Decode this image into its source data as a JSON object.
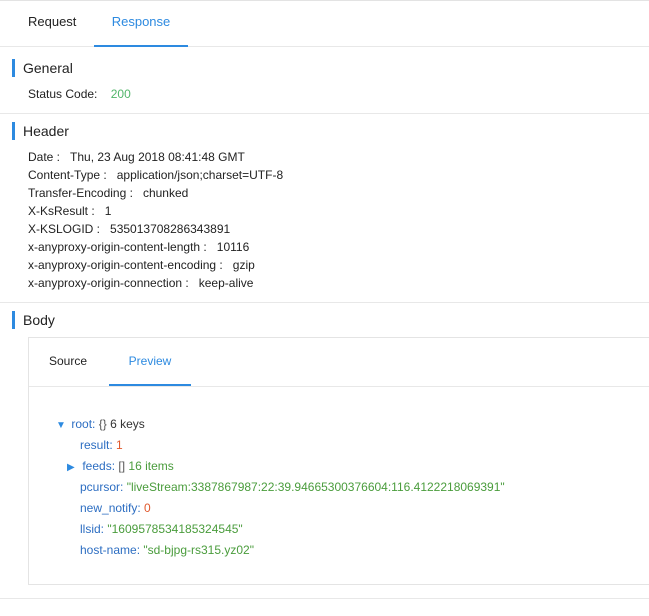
{
  "tabs": {
    "request": "Request",
    "response": "Response"
  },
  "general": {
    "title": "General",
    "status_label": "Status Code:",
    "status_value": "200"
  },
  "header": {
    "title": "Header",
    "rows": [
      {
        "k": "Date :",
        "v": "Thu, 23 Aug 2018 08:41:48 GMT"
      },
      {
        "k": "Content-Type :",
        "v": "application/json;charset=UTF-8"
      },
      {
        "k": "Transfer-Encoding :",
        "v": "chunked"
      },
      {
        "k": "X-KsResult :",
        "v": "1"
      },
      {
        "k": "X-KSLOGID :",
        "v": "535013708286343891"
      },
      {
        "k": "x-anyproxy-origin-content-length :",
        "v": "10116"
      },
      {
        "k": "x-anyproxy-origin-content-encoding :",
        "v": "gzip"
      },
      {
        "k": "x-anyproxy-origin-connection :",
        "v": "keep-alive"
      }
    ]
  },
  "body": {
    "title": "Body",
    "tabs": {
      "source": "Source",
      "preview": "Preview"
    },
    "tree": {
      "root_key": "root:",
      "root_braces": "{}",
      "root_meta": "6 keys",
      "result_key": "result:",
      "result_val": "1",
      "feeds_key": "feeds:",
      "feeds_braces": "[]",
      "feeds_meta": "16 items",
      "pcursor_key": "pcursor:",
      "pcursor_val": "\"liveStream:3387867987:22:39.94665300376604:116.4122218069391\"",
      "new_notify_key": "new_notify:",
      "new_notify_val": "0",
      "llsid_key": "llsid:",
      "llsid_val": "\"1609578534185324545\"",
      "host_key": "host-name:",
      "host_val": "\"sd-bjpg-rs315.yz02\""
    }
  },
  "colors": {
    "accent": "#2d8ae0",
    "string": "#4a9c3c",
    "number": "#e0582c",
    "key": "#2d6ec2"
  },
  "icons": {
    "expanded": "triangle-down-icon",
    "collapsed": "triangle-right-icon"
  }
}
